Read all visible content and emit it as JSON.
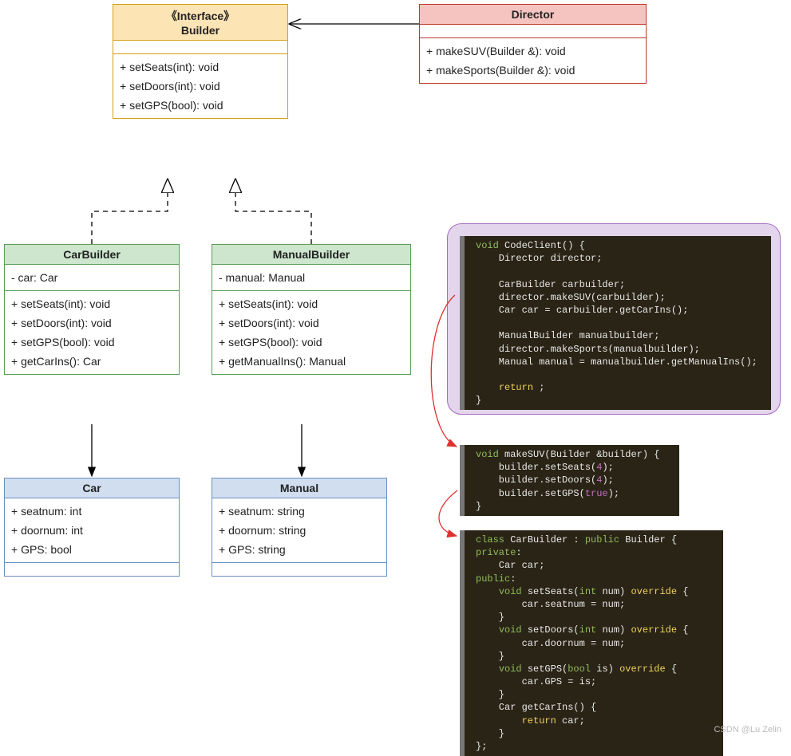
{
  "builder": {
    "stereotype": "《Interface》",
    "name": "Builder",
    "methods": [
      "+ setSeats(int): void",
      "+ setDoors(int): void",
      "+ setGPS(bool): void"
    ]
  },
  "director": {
    "name": "Director",
    "methods": [
      "+ makeSUV(Builder &): void",
      "+ makeSports(Builder &): void"
    ]
  },
  "carbuilder": {
    "name": "CarBuilder",
    "attrs": [
      "- car: Car"
    ],
    "methods": [
      "+ setSeats(int): void",
      "+ setDoors(int): void",
      "+ setGPS(bool): void",
      "+ getCarIns(): Car"
    ]
  },
  "manualbuilder": {
    "name": "ManualBuilder",
    "attrs": [
      "- manual: Manual"
    ],
    "methods": [
      "+ setSeats(int): void",
      "+ setDoors(int): void",
      "+ setGPS(bool): void",
      "+ getManualIns(): Manual"
    ]
  },
  "car": {
    "name": "Car",
    "attrs": [
      "+ seatnum: int",
      "+ doornum: int",
      "+ GPS: bool"
    ]
  },
  "manual": {
    "name": "Manual",
    "attrs": [
      "+ seatnum: string",
      "+ doornum: string",
      "+ GPS: string"
    ]
  },
  "code1": {
    "l1a": "void",
    "l1b": " CodeClient() {",
    "l2": "    Director director;",
    "l3": "",
    "l4": "    CarBuilder carbuilder;",
    "l5": "    director.makeSUV(carbuilder);",
    "l6a": "    Car car = carbuilder.getCarIns();",
    "l7": "",
    "l8": "    ManualBuilder manualbuilder;",
    "l9": "    director.makeSports(manualbuilder);",
    "l10": "    Manual manual = manualbuilder.getManualIns();",
    "l11": "",
    "l12a": "    ",
    "l12b": "return",
    "l12c": " ;",
    "l13": "}"
  },
  "code2": {
    "l1a": "void",
    "l1b": " makeSUV(Builder &builder) {",
    "l2a": "    builder.setSeats(",
    "l2b": "4",
    "l2c": ");",
    "l3a": "    builder.setDoors(",
    "l3b": "4",
    "l3c": ");",
    "l4a": "    builder.setGPS(",
    "l4b": "true",
    "l4c": ");",
    "l5": "}"
  },
  "code3": {
    "l1a": "class",
    "l1b": " CarBuilder : ",
    "l1c": "public",
    "l1d": " Builder {",
    "l2a": "private",
    "l2b": ":",
    "l3": "    Car car;",
    "l4a": "public",
    "l4b": ":",
    "l5a": "    ",
    "l5b": "void",
    "l5c": " setSeats(",
    "l5d": "int",
    "l5e": " num) ",
    "l5f": "override",
    "l5g": " {",
    "l6": "        car.seatnum = num;",
    "l7": "    }",
    "l8a": "    ",
    "l8b": "void",
    "l8c": " setDoors(",
    "l8d": "int",
    "l8e": " num) ",
    "l8f": "override",
    "l8g": " {",
    "l9": "        car.doornum = num;",
    "l10": "    }",
    "l11a": "    ",
    "l11b": "void",
    "l11c": " setGPS(",
    "l11d": "bool",
    "l11e": " is) ",
    "l11f": "override",
    "l11g": " {",
    "l12": "        car.GPS = is;",
    "l13": "    }",
    "l14": "    Car getCarIns() {",
    "l15a": "        ",
    "l15b": "return",
    "l15c": " car;",
    "l16": "    }",
    "l17": "};"
  },
  "watermark": "CSDN @Lu Zelin"
}
